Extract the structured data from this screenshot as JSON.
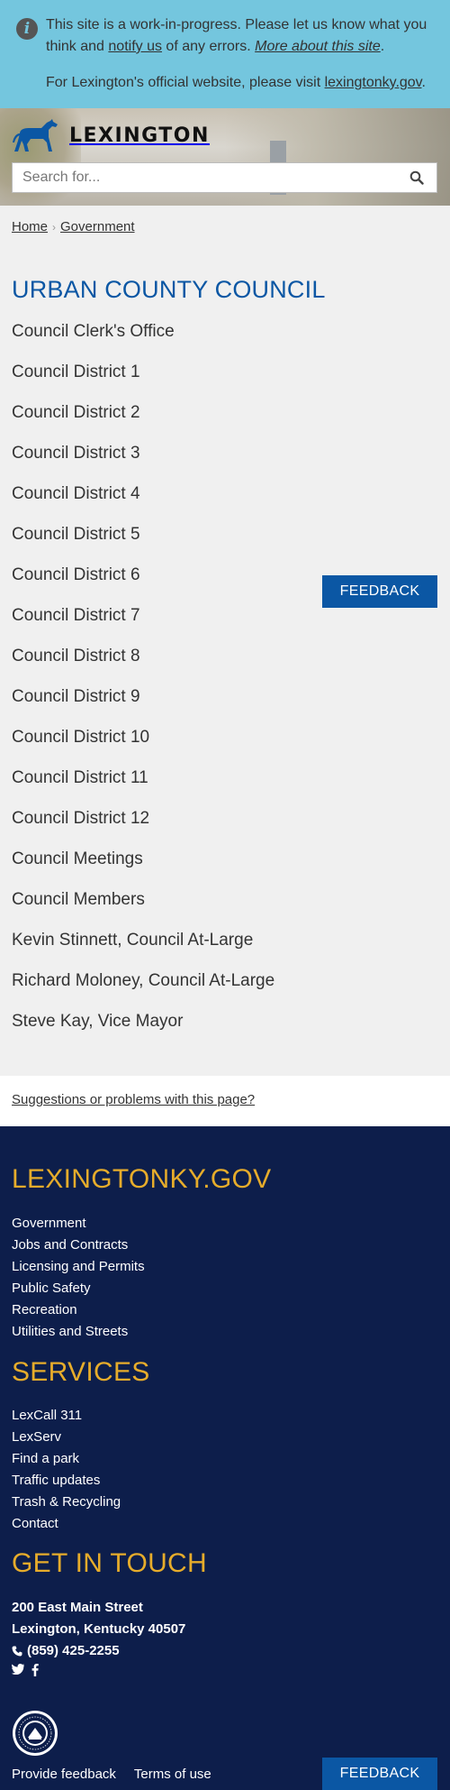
{
  "alert": {
    "text_1": "This site is a work-in-progress. Please let us know what you think and ",
    "notify_link": "notify us",
    "text_2": " of any errors. ",
    "more_link": "More about this site",
    "text_3": ".",
    "official_text": "For Lexington's official website, please visit ",
    "official_link": "lexingtonky.gov",
    "official_end": "."
  },
  "header": {
    "brand": "LEXINGTON",
    "search_placeholder": "Search for..."
  },
  "breadcrumb": {
    "home": "Home",
    "separator": "›",
    "current": "Government"
  },
  "main": {
    "title": "URBAN COUNTY COUNCIL",
    "items": [
      "Council Clerk's Office",
      "Council District 1",
      "Council District 2",
      "Council District 3",
      "Council District 4",
      "Council District 5",
      "Council District 6",
      "Council District 7",
      "Council District 8",
      "Council District 9",
      "Council District 10",
      "Council District 11",
      "Council District 12",
      "Council Meetings",
      "Council Members",
      "Kevin Stinnett, Council At-Large",
      "Richard Moloney, Council At-Large",
      "Steve Kay, Vice Mayor"
    ]
  },
  "feedback": {
    "label": "FEEDBACK"
  },
  "suggest": {
    "label": "Suggestions or problems with this page?"
  },
  "footer": {
    "site_heading": "LEXINGTONKY.GOV",
    "site_links": [
      "Government",
      "Jobs and Contracts",
      "Licensing and Permits",
      "Public Safety",
      "Recreation",
      "Utilities and Streets"
    ],
    "services_heading": "SERVICES",
    "services_links": [
      "LexCall 311",
      "LexServ",
      "Find a park",
      "Traffic updates",
      "Trash & Recycling",
      "Contact"
    ],
    "touch_heading": "GET IN TOUCH",
    "address_1": "200 East Main Street",
    "address_2": "Lexington, Kentucky 40507",
    "phone": "(859) 425-2255",
    "provide_feedback": "Provide feedback",
    "terms": "Terms of use"
  },
  "colors": {
    "alert_bg": "#74c6de",
    "brand_blue": "#0b57a4",
    "footer_bg": "#0d1e4b",
    "footer_heading": "#e6ac2b"
  }
}
